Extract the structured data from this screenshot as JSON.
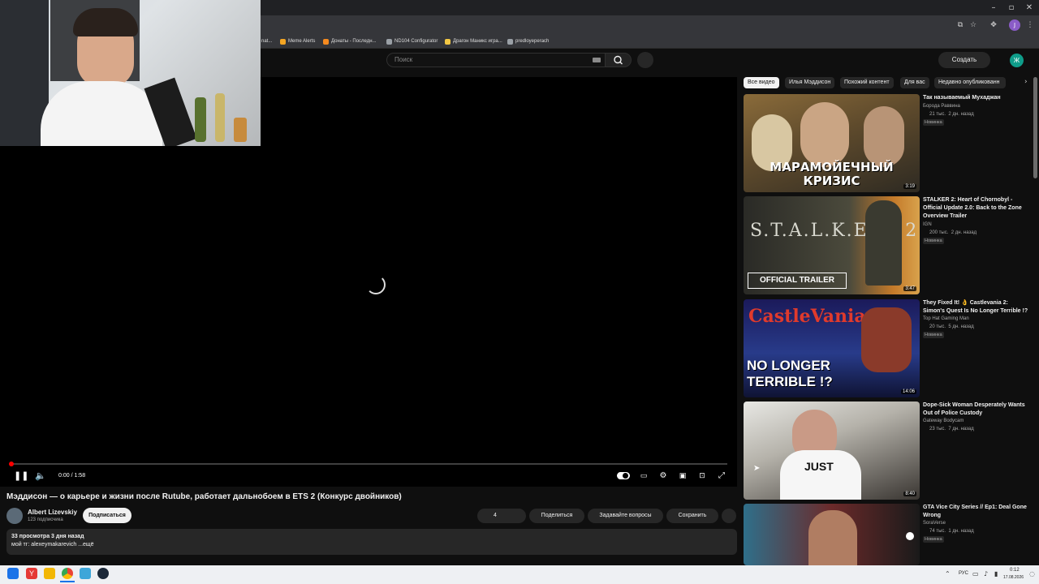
{
  "browser": {
    "bookmarks": [
      "nat...",
      "Meme Alerts",
      "Донаты - Последн...",
      "ND104 Configurator",
      "Драгон Маникс игра...",
      "predloyeperach"
    ]
  },
  "header": {
    "search_placeholder": "Поиск",
    "create_label": "Создать",
    "account_initial": "Ж"
  },
  "player": {
    "time": "0:00 / 1:58",
    "progress": 0.0
  },
  "video": {
    "title": "Мэддисон — о карьере и жизни после Rutube, работает дальнобоем в ETS 2 (Конкурс двойников)",
    "channel": "Albert Lizevskiy",
    "subscribers": "123 подписчика",
    "subscribe_label": "Подписаться",
    "likes": "4",
    "share_label": "Поделиться",
    "ask_label": "Задавайте вопросы",
    "save_label": "Сохранить",
    "meta": "33 просмотра  3 дня назад",
    "description": "мой тг: alexeymakarevich ...ещё"
  },
  "chips": [
    "Все видео",
    "Илья Мэддисон",
    "Похожий контент",
    "Для вас",
    "Недавно опубликованн"
  ],
  "recommendations": [
    {
      "title": "Так называемый Мухаджан",
      "channel": "Борода Раввина",
      "views": "21 тыс.",
      "age": "2 дн. назад",
      "badge": "Новинка",
      "duration": "3:19",
      "thumb_text": "МАРАМОЙЕЧНЫЙ КРИЗИС"
    },
    {
      "title": "STALKER 2: Heart of Chornobyl - Official Update 2.0: Back to the Zone Overview Trailer",
      "channel": "IGN",
      "views": "200 тыс.",
      "age": "2 дн. назад",
      "badge": "Новинка",
      "duration": "3:47",
      "thumb_text": "OFFICIAL TRAILER"
    },
    {
      "title": "They Fixed It! 👌 Castlevania 2: Simon's Quest Is No Longer Terrible !?",
      "channel": "Top Hat Gaming Man",
      "views": "20 тыс.",
      "age": "5 дн. назад",
      "badge": "Новинка",
      "duration": "14:06",
      "thumb_text": "NO LONGER TERRIBLE !?"
    },
    {
      "title": "Dope-Sick Woman Desperately Wants Out of Police Custody",
      "channel": "Gateway Bodycam",
      "views": "23 тыс.",
      "age": "7 дн. назад",
      "badge": "",
      "duration": "8:40",
      "thumb_text": ""
    },
    {
      "title": "GTA Vice City Series // Ep1: Deal Gone Wrong",
      "channel": "SoraVerse",
      "views": "74 тыс.",
      "age": "1 дн. назад",
      "badge": "Новинка",
      "duration": "",
      "thumb_text": ""
    }
  ],
  "taskbar": {
    "lang": "РУС",
    "time": "0:12",
    "date": "17.08.2026"
  }
}
